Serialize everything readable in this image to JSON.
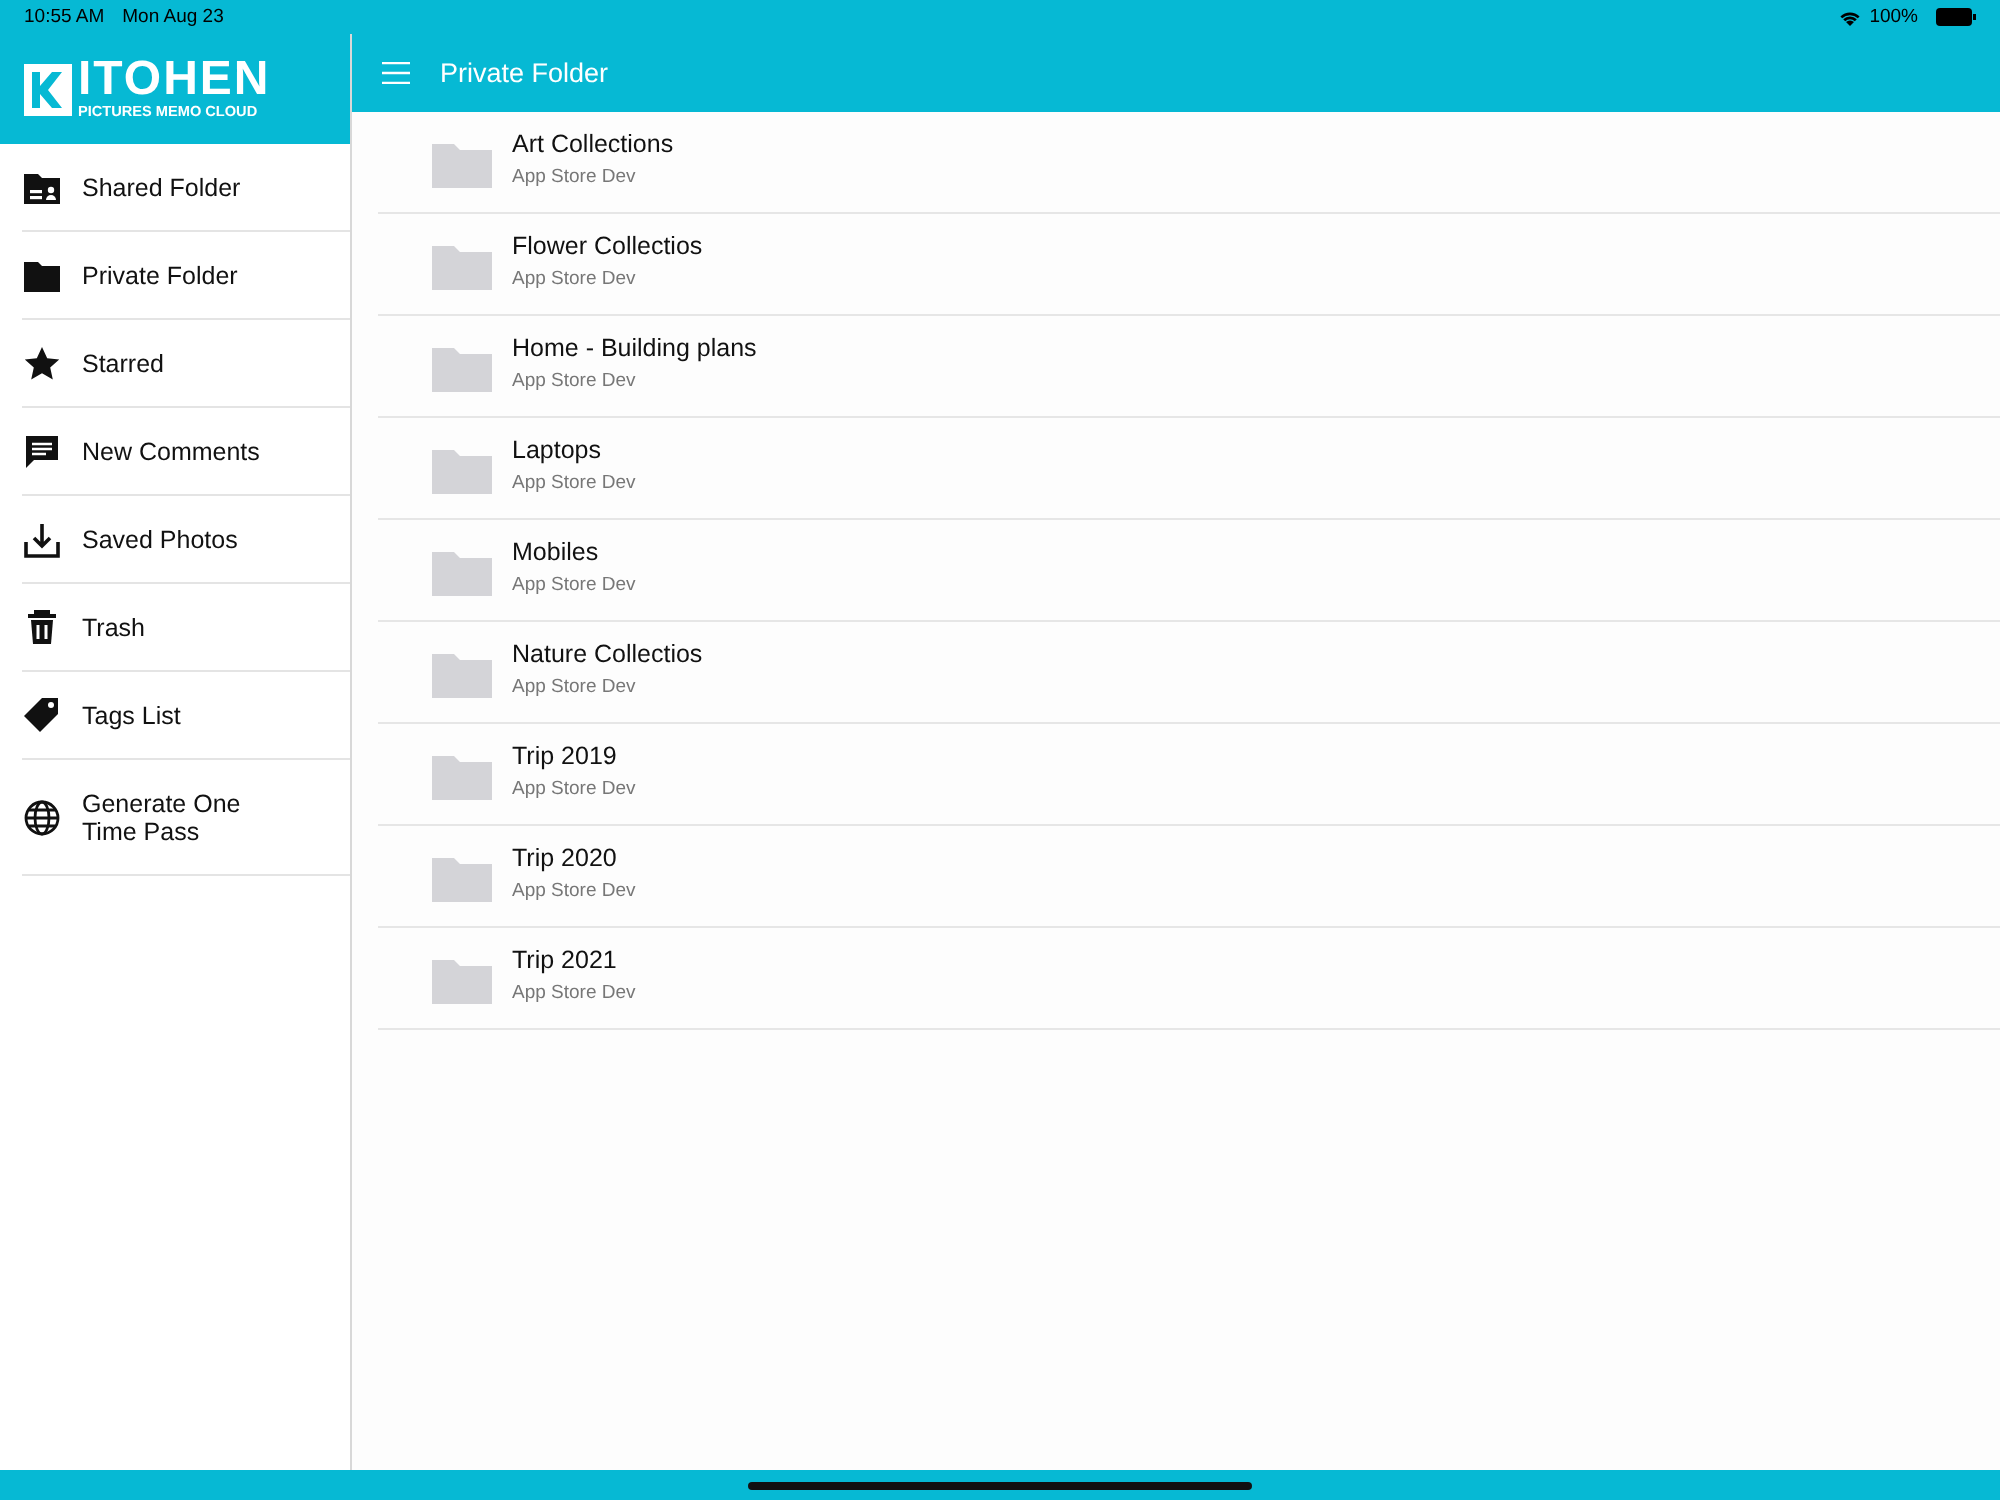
{
  "status_bar": {
    "time": "10:55 AM",
    "date": "Mon Aug 23",
    "battery": "100%"
  },
  "logo": {
    "title": "ITOHEN",
    "subtitle": "PICTURES MEMO CLOUD"
  },
  "sidebar": {
    "items": [
      {
        "kind": "shared",
        "label": "Shared Folder"
      },
      {
        "kind": "folder",
        "label": "Private Folder"
      },
      {
        "kind": "star",
        "label": "Starred"
      },
      {
        "kind": "comment",
        "label": "New Comments"
      },
      {
        "kind": "download",
        "label": "Saved Photos"
      },
      {
        "kind": "trash",
        "label": "Trash"
      },
      {
        "kind": "tag",
        "label": "Tags List"
      },
      {
        "kind": "globe",
        "label": "Generate One Time Pass"
      }
    ]
  },
  "header": {
    "title": "Private Folder"
  },
  "folders": [
    {
      "name": "Art Collections",
      "owner": "App Store Dev"
    },
    {
      "name": "Flower Collectios",
      "owner": "App Store Dev"
    },
    {
      "name": "Home - Building plans",
      "owner": "App Store Dev"
    },
    {
      "name": "Laptops",
      "owner": "App Store Dev"
    },
    {
      "name": "Mobiles",
      "owner": "App Store Dev"
    },
    {
      "name": "Nature Collectios",
      "owner": "App Store Dev"
    },
    {
      "name": "Trip 2019",
      "owner": "App Store Dev"
    },
    {
      "name": "Trip 2020",
      "owner": "App Store Dev"
    },
    {
      "name": "Trip 2021",
      "owner": "App Store Dev"
    }
  ]
}
